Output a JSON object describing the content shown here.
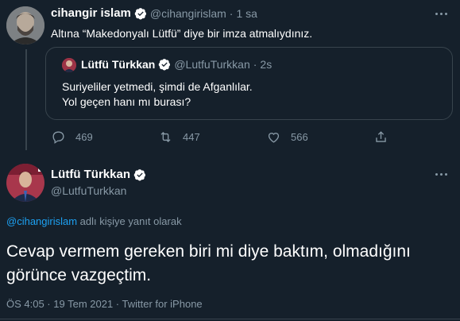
{
  "reply_tweet": {
    "display_name": "cihangir islam",
    "handle": "@cihangirislam",
    "separator": "·",
    "time": "1 sa",
    "text": "Altına “Makedonyalı Lütfü” diye bir imza atmalıydınız.",
    "quoted": {
      "display_name": "Lütfü Türkkan",
      "handle": "@LutfuTurkkan",
      "separator": "·",
      "time": "2s",
      "line1": "Suriyeliler yetmedi, şimdi de Afganlılar.",
      "line2": "Yol geçen hanı mı burası?"
    },
    "actions": {
      "replies": "469",
      "retweets": "447",
      "likes": "566"
    }
  },
  "main_tweet": {
    "display_name": "Lütfü Türkkan",
    "handle": "@LutfuTurkkan",
    "reply_to_handle": "@cihangirislam",
    "reply_to_suffix": " adlı kişiye yanıt olarak",
    "text": "Cevap vermem gereken biri mi diye baktım, olmadığını görünce vazgeçtim.",
    "meta": "ÖS 4:05 · 19 Tem 2021 · Twitter for iPhone"
  },
  "colors": {
    "background": "#15202b",
    "accent": "#1da1f2",
    "muted": "#8899a6",
    "border": "#38444d"
  }
}
